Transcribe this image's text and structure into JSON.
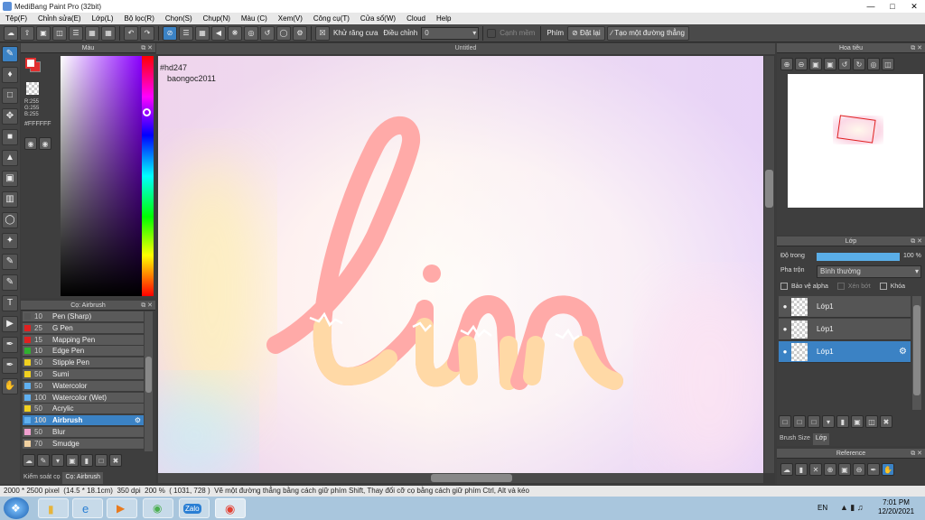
{
  "window": {
    "title": "MediBang Paint Pro (32bit)"
  },
  "menu": [
    "Tệp(F)",
    "Chỉnh sửa(E)",
    "Lớp(L)",
    "Bộ lọc(R)",
    "Chọn(S)",
    "Chụp(N)",
    "Màu (C)",
    "Xem(V)",
    "Công cụ(T)",
    "Cửa sổ(W)",
    "Cloud",
    "Help"
  ],
  "toolbar": {
    "antialias_label": "Khử răng cưa",
    "adjust_label": "Điều chỉnh",
    "adjust_value": "0",
    "edge_label": "Cạnh mềm",
    "key_label": "Phím",
    "reset_label": "Đặt lại",
    "straight_label": "Tạo một đường thẳng"
  },
  "color_panel": {
    "title": "Màu",
    "r": "R:255",
    "g": "G:255",
    "b": "B:255",
    "hex": "#FFFFFF",
    "fg_color": "#ffffff",
    "bg_color": "#e03030"
  },
  "brush_panel": {
    "title": "Cọ: Airbrush",
    "items": [
      {
        "size": "10",
        "name": "Pen (Sharp)",
        "color": "#555555"
      },
      {
        "size": "25",
        "name": "G Pen",
        "color": "#e02020"
      },
      {
        "size": "15",
        "name": "Mapping Pen",
        "color": "#e02020"
      },
      {
        "size": "10",
        "name": "Edge Pen",
        "color": "#30b030"
      },
      {
        "size": "50",
        "name": "Stipple Pen",
        "color": "#f0d020"
      },
      {
        "size": "50",
        "name": "Sumi",
        "color": "#f0d020"
      },
      {
        "size": "50",
        "name": "Watercolor",
        "color": "#60b0f0"
      },
      {
        "size": "100",
        "name": "Watercolor (Wet)",
        "color": "#60b0f0"
      },
      {
        "size": "50",
        "name": "Acrylic",
        "color": "#f0d020"
      },
      {
        "size": "100",
        "name": "Airbrush",
        "color": "#60b0f0"
      },
      {
        "size": "50",
        "name": "Blur",
        "color": "#f0a0d0"
      },
      {
        "size": "70",
        "name": "Smudge",
        "color": "#f0d0a0"
      }
    ],
    "selected_index": 9,
    "tabs": [
      "Kiểm soát cọ",
      "Cọ: Airbrush"
    ]
  },
  "canvas": {
    "tab_title": "Untitled",
    "text_line1": "#hd247",
    "text_line2": "baongoc2011"
  },
  "navigator": {
    "title": "Hoa tiêu"
  },
  "layer_panel": {
    "title": "Lớp",
    "opacity_label": "Độ trong",
    "opacity_value": "100 %",
    "opacity_fraction": 1.0,
    "blend_label": "Pha trộn",
    "blend_value": "Bình thường",
    "protect_alpha_label": "Bảo vệ alpha",
    "clip_label": "Xén bớt",
    "lock_label": "Khóa",
    "layers": [
      {
        "name": "Lớp1",
        "selected": false
      },
      {
        "name": "Lớp1",
        "selected": false
      },
      {
        "name": "Lớp1",
        "selected": true
      }
    ],
    "tabs": [
      "Brush Size",
      "Lớp"
    ]
  },
  "reference_panel": {
    "title": "Reference"
  },
  "status": {
    "size": "2000 * 2500 pixel",
    "cm": "(14.5 * 18.1cm)",
    "dpi": "350 dpi",
    "zoom": "200 %",
    "coords": "( 1031, 728 )",
    "hint": "Vẽ một đường thẳng bằng cách giữ phím Shift, Thay đổi cỡ cọ bằng cách giữ phím Ctrl, Alt và kéo"
  },
  "taskbar": {
    "lang": "EN",
    "time": "7:01 PM",
    "date": "12/20/2021",
    "zalo": "Zalo"
  }
}
